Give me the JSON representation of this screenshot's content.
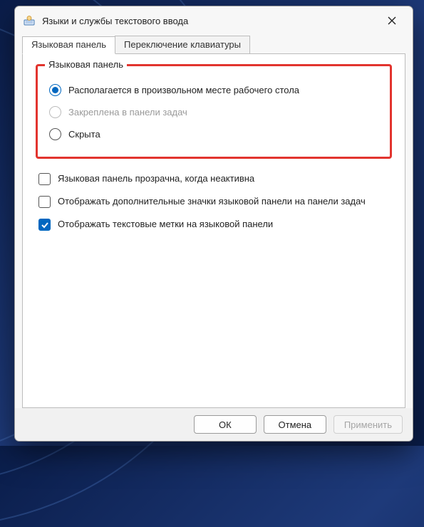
{
  "window": {
    "title": "Языки и службы текстового ввода"
  },
  "tabs": {
    "panel": "Языковая панель",
    "switch": "Переключение клавиатуры"
  },
  "group": {
    "legend": "Языковая панель",
    "opt_floating": "Располагается в произвольном месте рабочего стола",
    "opt_taskbar": "Закреплена в панели задач",
    "opt_hidden": "Скрыта"
  },
  "checks": {
    "transparent": "Языковая панель прозрачна, когда неактивна",
    "extra_icons": "Отображать дополнительные значки языковой панели на панели задач",
    "text_labels": "Отображать текстовые метки на языковой панели"
  },
  "buttons": {
    "ok": "ОК",
    "cancel": "Отмена",
    "apply": "Применить"
  }
}
